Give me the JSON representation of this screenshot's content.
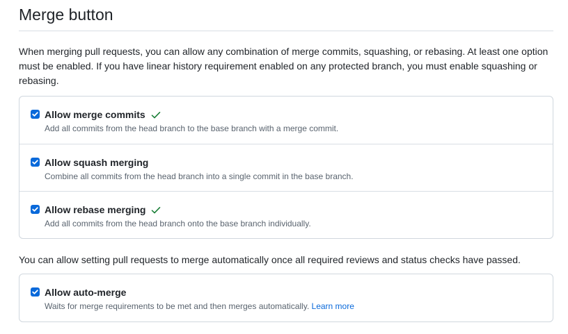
{
  "section": {
    "title": "Merge button",
    "intro": "When merging pull requests, you can allow any combination of merge commits, squashing, or rebasing. At least one option must be enabled. If you have linear history requirement enabled on any protected branch, you must enable squashing or rebasing."
  },
  "merge_options": [
    {
      "label": "Allow merge commits",
      "description": "Add all commits from the head branch to the base branch with a merge commit.",
      "checked": true,
      "saved_indicator": true
    },
    {
      "label": "Allow squash merging",
      "description": "Combine all commits from the head branch into a single commit in the base branch.",
      "checked": true,
      "saved_indicator": false
    },
    {
      "label": "Allow rebase merging",
      "description": "Add all commits from the head branch onto the base branch individually.",
      "checked": true,
      "saved_indicator": true
    }
  ],
  "auto_merge": {
    "note": "You can allow setting pull requests to merge automatically once all required reviews and status checks have passed.",
    "label": "Allow auto-merge",
    "description": "Waits for merge requirements to be met and then merges automatically.",
    "link_text": "Learn more",
    "checked": true
  },
  "icons": {
    "checkbox": "checkbox-checked-icon",
    "saved": "check-icon"
  },
  "colors": {
    "accent": "#0969da",
    "success": "#1a7f37",
    "border": "#d0d7de",
    "text": "#1f2328",
    "muted": "#59636e"
  }
}
